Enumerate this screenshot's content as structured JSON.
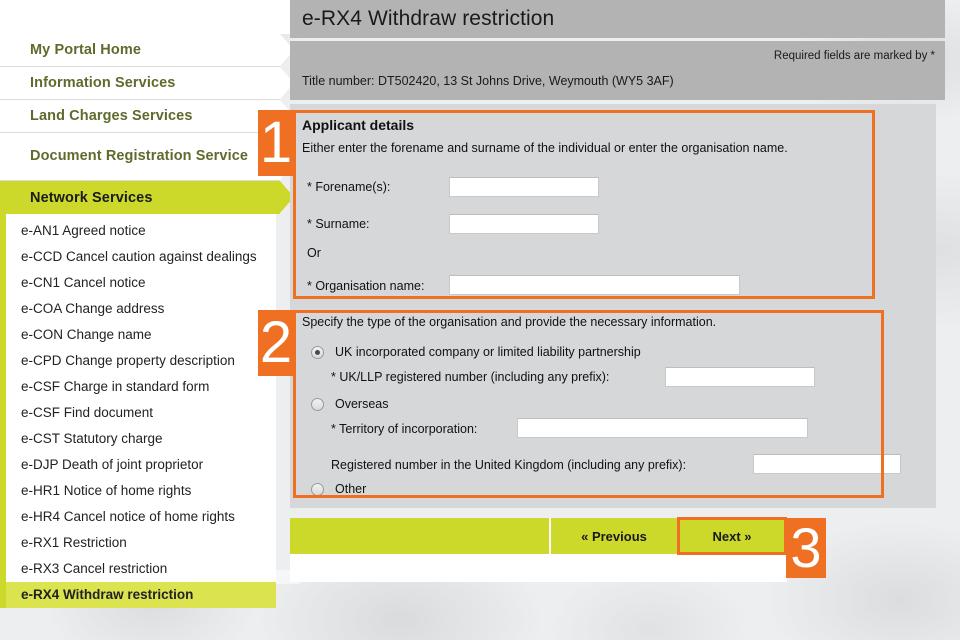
{
  "colors": {
    "accent_orange": "#ef6f23",
    "brand_green": "#ccd92b",
    "nav_text_green": "#5d6b2c",
    "header_gray": "#b3b3b3",
    "panel_gray": "#d6d7d9",
    "page_bg": "#eceef0"
  },
  "sidebar": {
    "primary_items": [
      {
        "label": "My Portal Home",
        "active": false
      },
      {
        "label": "Information Services",
        "active": false
      },
      {
        "label": "Land Charges Services",
        "active": false
      },
      {
        "label": "Document Registration Service",
        "active": false
      },
      {
        "label": "Network Services",
        "active": true
      }
    ],
    "sub_items": [
      {
        "label": "e-AN1 Agreed notice",
        "selected": false
      },
      {
        "label": "e-CCD Cancel caution against dealings",
        "selected": false
      },
      {
        "label": "e-CN1 Cancel notice",
        "selected": false
      },
      {
        "label": "e-COA Change address",
        "selected": false
      },
      {
        "label": "e-CON Change name",
        "selected": false
      },
      {
        "label": "e-CPD Change property description",
        "selected": false
      },
      {
        "label": "e-CSF Charge in standard form",
        "selected": false
      },
      {
        "label": "e-CSF Find document",
        "selected": false
      },
      {
        "label": "e-CST Statutory charge",
        "selected": false
      },
      {
        "label": "e-DJP Death of joint proprietor",
        "selected": false
      },
      {
        "label": "e-HR1 Notice of home rights",
        "selected": false
      },
      {
        "label": "e-HR4 Cancel notice of home rights",
        "selected": false
      },
      {
        "label": "e-RX1 Restriction",
        "selected": false
      },
      {
        "label": "e-RX3 Cancel restriction",
        "selected": false
      },
      {
        "label": "e-RX4 Withdraw restriction",
        "selected": true
      }
    ]
  },
  "header": {
    "title": "e-RX4 Withdraw restriction",
    "required_note": "Required fields are marked by *",
    "title_number": "Title number: DT502420, 13 St Johns Drive, Weymouth (WY5 3AF)"
  },
  "section1": {
    "heading": "Applicant details",
    "instruction": "Either enter the forename and surname of the individual or enter the organisation name.",
    "forename_label": "* Forename(s):",
    "forename_value": "",
    "surname_label": "* Surname:",
    "surname_value": "",
    "or_label": "Or",
    "organisation_label": "* Organisation name:",
    "organisation_value": ""
  },
  "section2": {
    "instruction": "Specify the type of the organisation and provide the necessary information.",
    "option_uk": "UK incorporated company or limited liability partnership",
    "uk_number_label": "* UK/LLP registered number (including any prefix):",
    "uk_number_value": "",
    "option_overseas": "Overseas",
    "territory_label": "* Territory of incorporation:",
    "territory_value": "",
    "uk_reg_number_label": "Registered number in the United Kingdom (including any prefix):",
    "uk_reg_number_value": "",
    "option_other": "Other",
    "selected_option": "UK incorporated company or limited liability partnership"
  },
  "buttons": {
    "previous": "« Previous",
    "next": "Next »"
  },
  "annotations": {
    "badge1": "1",
    "badge2": "2",
    "badge3": "3"
  }
}
